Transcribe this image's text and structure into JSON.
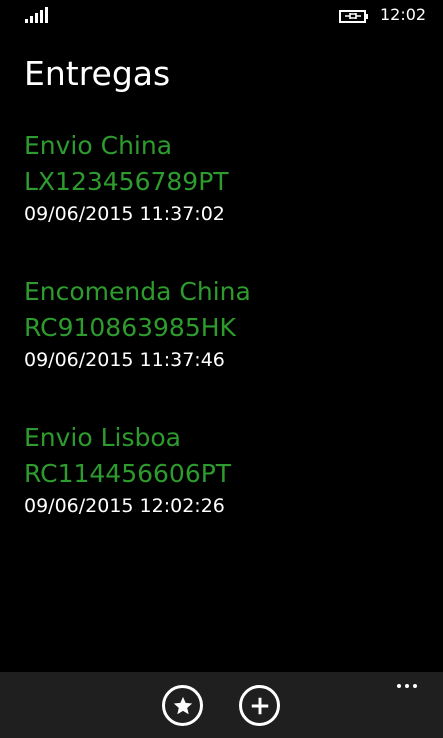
{
  "status_bar": {
    "time": "12:02",
    "signal_icon": "signal-strength-icon",
    "battery_icon": "battery-charging-icon"
  },
  "page": {
    "title": "Entregas"
  },
  "deliveries": [
    {
      "name": "Envio China",
      "code": "LX123456789PT",
      "date": "09/06/2015 11:37:02"
    },
    {
      "name": "Encomenda China",
      "code": "RC910863985HK",
      "date": "09/06/2015 11:37:46"
    },
    {
      "name": "Envio Lisboa",
      "code": "RC114456606PT",
      "date": "09/06/2015 12:02:26"
    }
  ],
  "app_bar": {
    "buttons": [
      {
        "icon": "star-icon"
      },
      {
        "icon": "plus-icon"
      }
    ],
    "more_icon": "ellipsis-icon"
  },
  "colors": {
    "background": "#000000",
    "accent": "#2e9b2e",
    "text": "#ffffff",
    "app_bar": "#1f1f1f"
  }
}
